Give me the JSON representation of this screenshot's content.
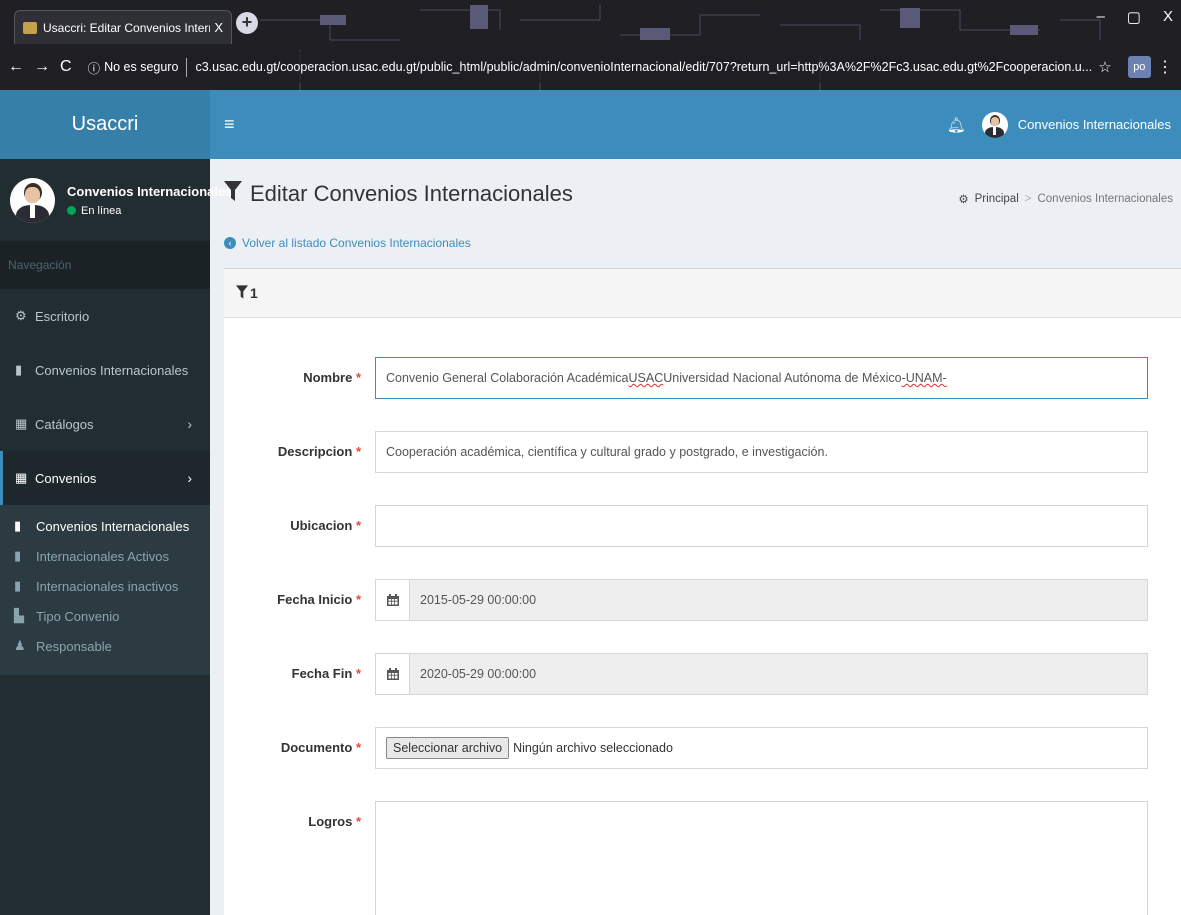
{
  "browser": {
    "tab_title": "Usaccri: Editar Convenios Interna",
    "tab_close": "X",
    "new_tab": "+",
    "win_min": "–",
    "win_max": "▢",
    "win_close": "X",
    "security_label": "No es seguro",
    "url": "c3.usac.edu.gt/cooperacion.usac.edu.gt/public_html/public/admin/convenioInternacional/edit/707?return_url=http%3A%2F%2Fc3.usac.edu.gt%2Fcooperacion.u...",
    "ext_label": "po"
  },
  "app": {
    "logo": "Usaccri",
    "user_name": "Convenios Internacionales",
    "user_status": "En línea"
  },
  "sidebar": {
    "header": "Navegación",
    "items": [
      {
        "label": "Escritorio"
      },
      {
        "label": "Convenios Internacionales"
      },
      {
        "label": "Catálogos"
      },
      {
        "label": "Convenios"
      }
    ],
    "subitems": [
      {
        "label": "Convenios Internacionales"
      },
      {
        "label": "Internacionales Activos"
      },
      {
        "label": "Internacionales inactivos"
      },
      {
        "label": "Tipo Convenio"
      },
      {
        "label": "Responsable"
      }
    ]
  },
  "content": {
    "title": "Editar Convenios Internacionales",
    "breadcrumb_home": "Principal",
    "breadcrumb_current": "Convenios Internacionales",
    "back_link": "Volver al listado Convenios Internacionales",
    "box_title": "1"
  },
  "form": {
    "nombre_label": "Nombre",
    "nombre_value_a": "Convenio General Colaboración Académica ",
    "nombre_value_b": "USAC",
    "nombre_value_c": " Universidad Nacional Autónoma de México ",
    "nombre_value_d": "-UNAM-",
    "descripcion_label": "Descripcion",
    "descripcion_value": "Cooperación académica, científica y cultural grado y postgrado, e investigación.",
    "ubicacion_label": "Ubicacion",
    "ubicacion_value": "",
    "fecha_inicio_label": "Fecha Inicio",
    "fecha_inicio_value": "2015-05-29 00:00:00",
    "fecha_fin_label": "Fecha Fin",
    "fecha_fin_value": "2020-05-29 00:00:00",
    "documento_label": "Documento",
    "file_button": "Seleccionar archivo",
    "file_status": "Ningún archivo seleccionado",
    "logros_label": "Logros",
    "required_mark": "*"
  },
  "colors": {
    "header_blue": "#3c8dbc",
    "logo_blue": "#367fa9",
    "sidebar_dark": "#222d32",
    "required_red": "#dd4b39"
  }
}
